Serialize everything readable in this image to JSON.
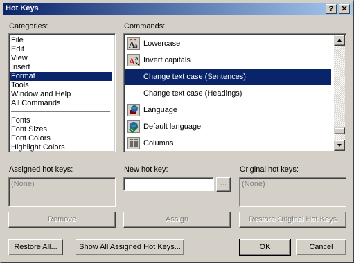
{
  "window": {
    "title": "Hot Keys",
    "help_button": "?",
    "close_button": "✕"
  },
  "categories": {
    "label": "Categories:",
    "items": [
      "File",
      "Edit",
      "View",
      "Insert",
      "Format",
      "Tools",
      "Window and Help",
      "All Commands"
    ],
    "selected": "Format",
    "items2": [
      "Fonts",
      "Font Sizes",
      "Font Colors",
      "Highlight Colors"
    ]
  },
  "commands": {
    "label": "Commands:",
    "items": [
      {
        "label": "Lowercase",
        "icon": "lowercase-icon"
      },
      {
        "label": "Invert capitals",
        "icon": "invert-capitals-icon"
      },
      {
        "label": "Change text case (Sentences)",
        "icon": ""
      },
      {
        "label": "Change text case (Headings)",
        "icon": ""
      },
      {
        "label": "Language",
        "icon": "language-icon"
      },
      {
        "label": "Default language",
        "icon": "default-language-icon"
      },
      {
        "label": "Columns",
        "icon": "columns-icon"
      }
    ],
    "selected": "Change text case (Sentences)"
  },
  "assigned": {
    "label": "Assigned hot keys:",
    "value": "(None)"
  },
  "new_hot_key": {
    "label": "New hot key:",
    "value": "",
    "browse_label": "..."
  },
  "original": {
    "label": "Original hot keys:",
    "value": "(None)"
  },
  "buttons": {
    "remove": "Remove",
    "assign": "Assign",
    "restore_original": "Restore Original Hot Keys",
    "restore_all": "Restore All...",
    "show_all": "Show All Assigned Hot Keys...",
    "ok": "OK",
    "cancel": "Cancel"
  },
  "colors": {
    "selection": "#0a246a",
    "face": "#d4d0c8"
  }
}
